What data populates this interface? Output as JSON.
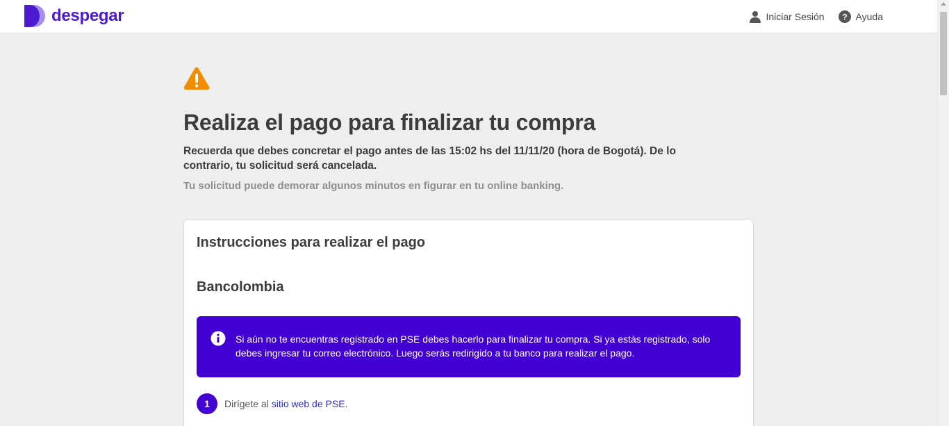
{
  "brand": {
    "name": "despegar",
    "icon": "despegar-logo-icon",
    "color": "#4c1bd1"
  },
  "nav": {
    "login_label": "Iniciar Sesión",
    "login_icon": "user-icon",
    "help_label": "Ayuda",
    "help_icon": "help-circle-icon"
  },
  "alert": {
    "icon": "warning-triangle-icon",
    "icon_color": "#f28c00",
    "title": "Realiza el pago para finalizar tu compra",
    "subtitle": "Recuerda que debes concretar el pago antes de las 15:02 hs del 11/11/20 (hora de Bogotá). De lo contrario, tu solicitud será cancelada.",
    "note": "Tu solicitud puede demorar algunos minutos en figurar en tu online banking."
  },
  "instructions": {
    "title": "Instrucciones para realizar el pago",
    "bank": "Bancolombia",
    "info": {
      "icon": "info-icon",
      "text": "Si aún no te encuentras registrado en PSE debes hacerlo para finalizar tu compra. Si ya estás registrado, solo debes ingresar tu correo electrónico. Luego serás redirigido a tu banco para realizar el pago.",
      "bg_color": "#4300d2"
    },
    "steps": [
      {
        "number": "1",
        "text_before": "Dirígete al ",
        "link_text": "sitio web de PSE",
        "text_after": "."
      }
    ]
  }
}
